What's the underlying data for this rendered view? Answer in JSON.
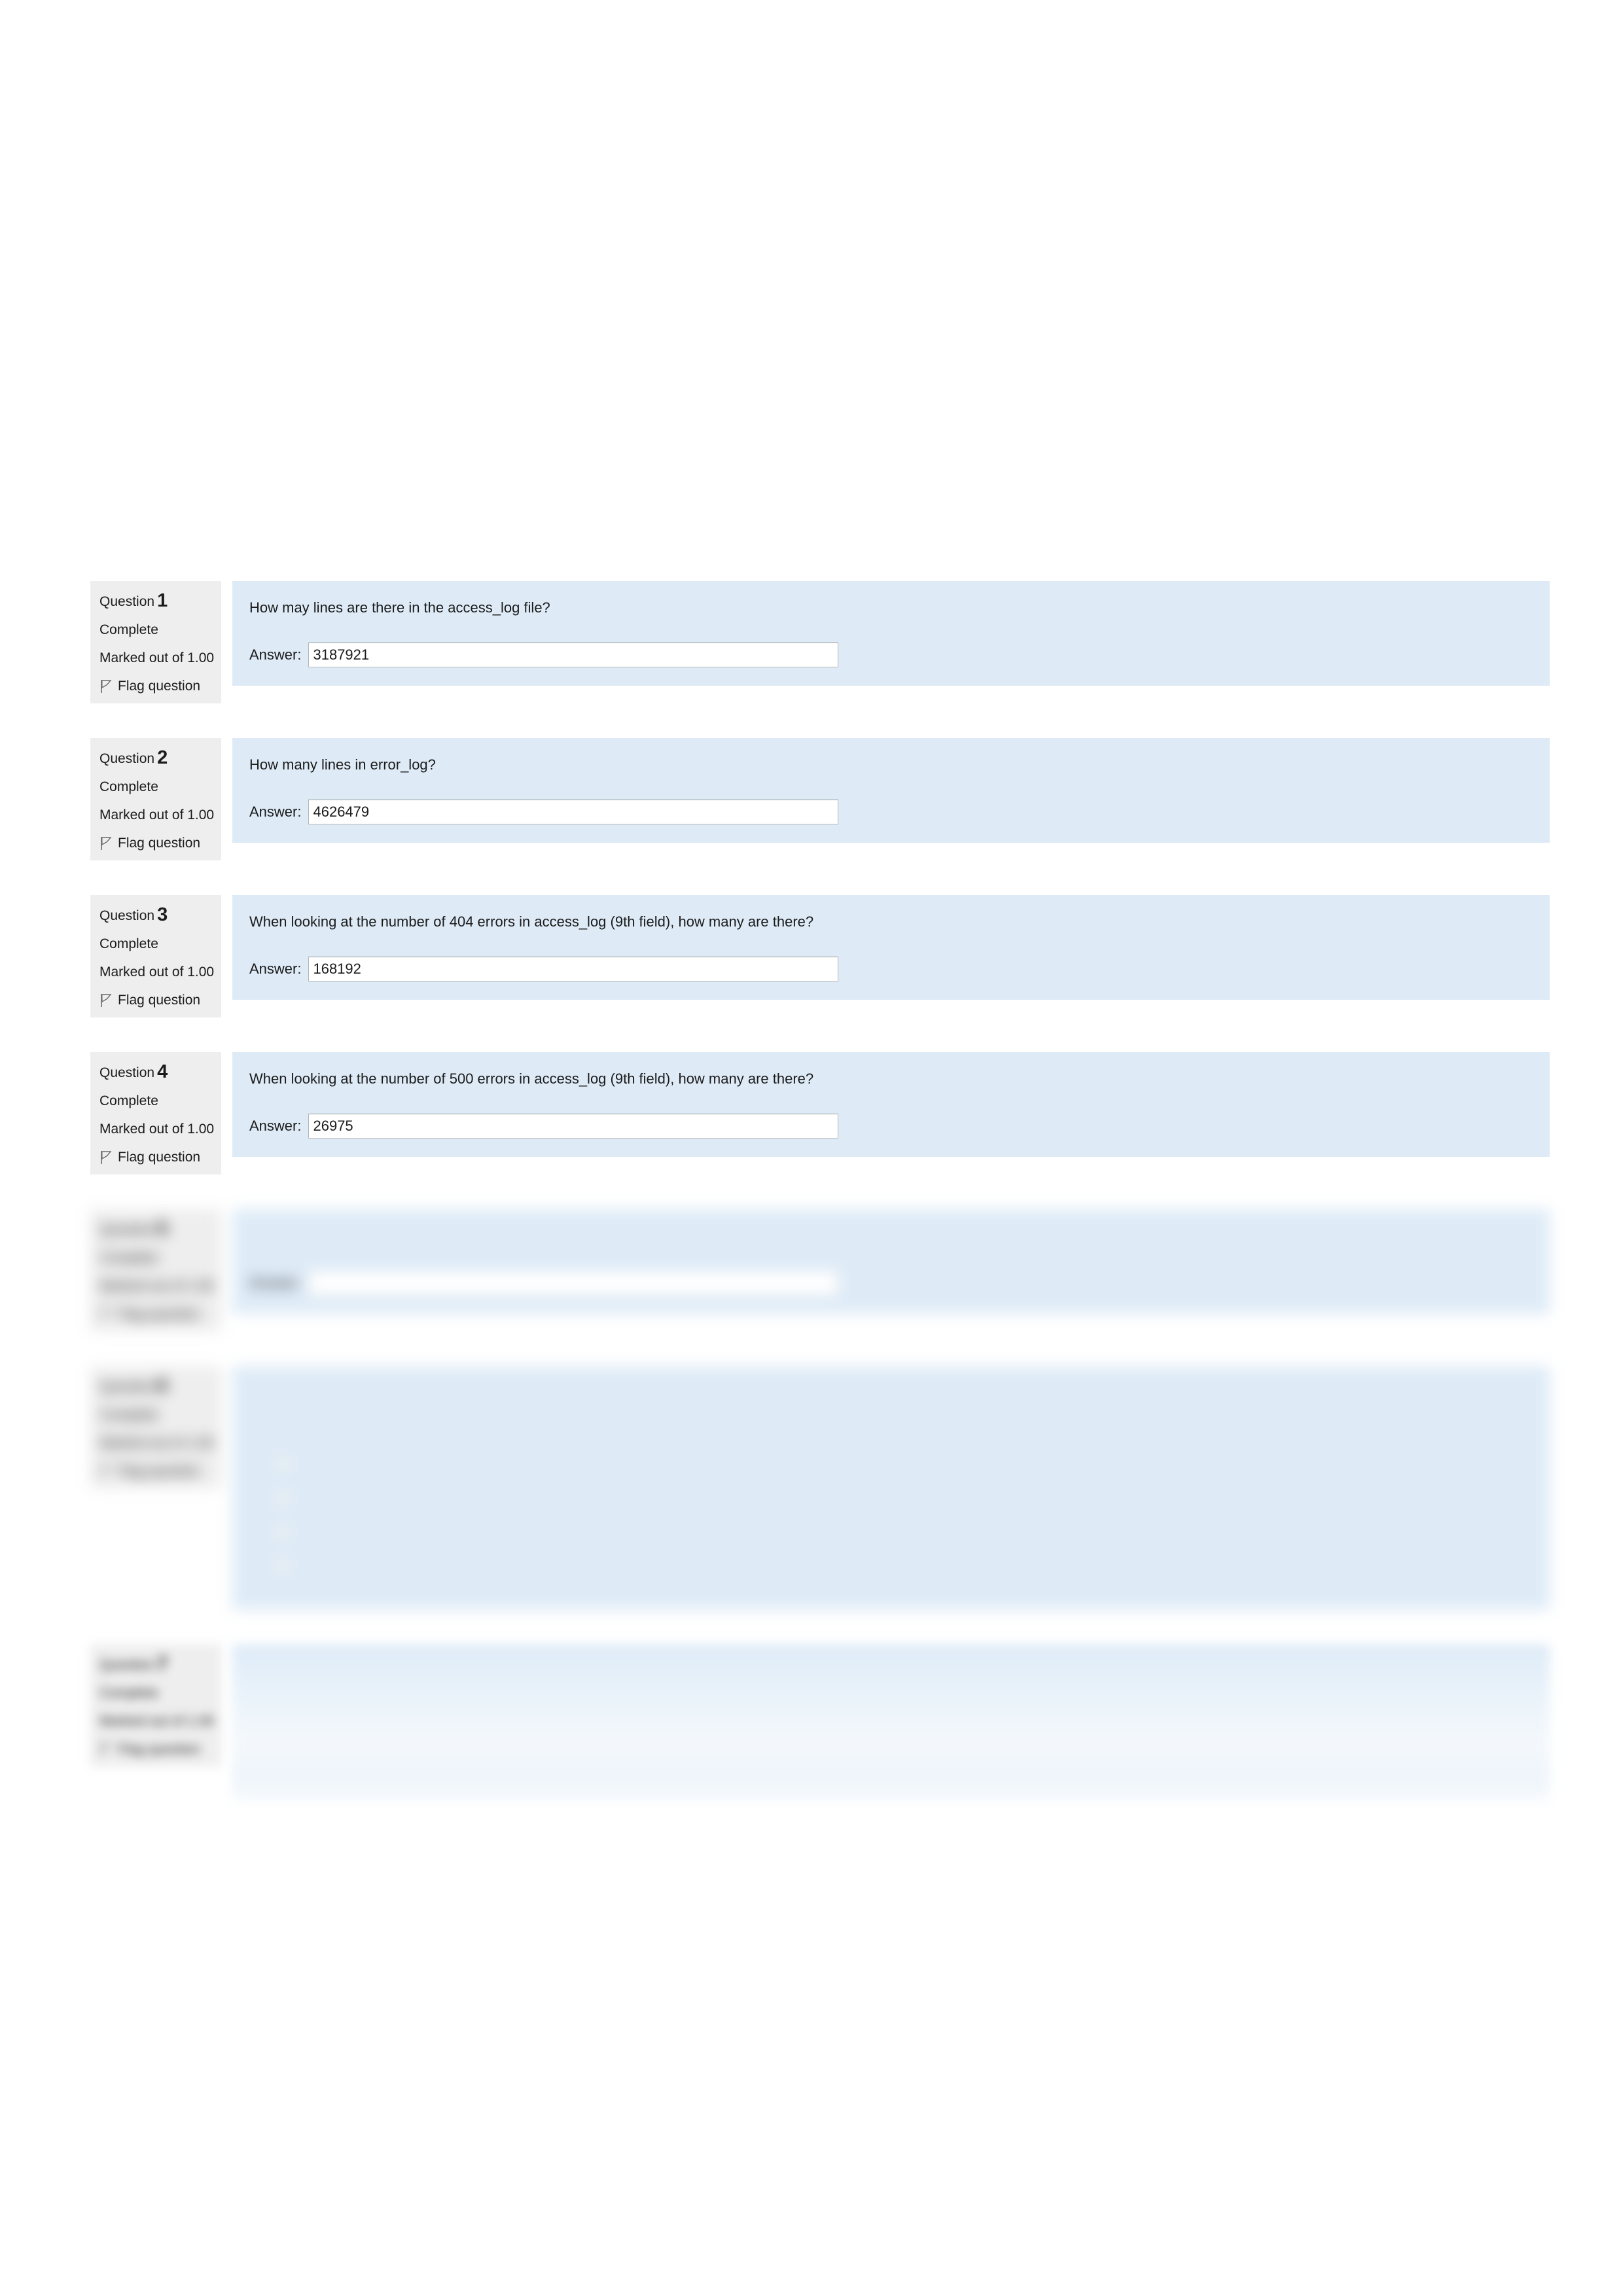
{
  "page": {
    "background": "#ffffff",
    "content_background": "#deebf7",
    "info_background": "#eeeeee"
  },
  "labels": {
    "question_word": "Question",
    "answer_label": "Answer:",
    "flag_label": "Flag question",
    "flag_icon": "flag-icon"
  },
  "questions": [
    {
      "number": "1",
      "state": "Complete",
      "grade": "Marked out of 1.00",
      "flag": "Flag question",
      "text": "How may lines are there in the access_log file?",
      "answer_label": "Answer:",
      "answer_value": "3187921",
      "answer_placeholder": "",
      "type": "shortanswer",
      "redacted": false
    },
    {
      "number": "2",
      "state": "Complete",
      "grade": "Marked out of 1.00",
      "flag": "Flag question",
      "text": "How many lines in error_log?",
      "answer_label": "Answer:",
      "answer_value": "4626479",
      "answer_placeholder": "",
      "type": "shortanswer",
      "redacted": false
    },
    {
      "number": "3",
      "state": "Complete",
      "grade": "Marked out of 1.00",
      "flag": "Flag question",
      "text": "When looking at the number of 404 errors in access_log (9th field), how many are there?",
      "answer_label": "Answer:",
      "answer_value": "168192",
      "answer_placeholder": "",
      "type": "shortanswer",
      "redacted": false
    },
    {
      "number": "4",
      "state": "Complete",
      "grade": "Marked out of 1.00",
      "flag": "Flag question",
      "text": "When looking at the number of 500 errors in access_log (9th field), how many are there?",
      "answer_label": "Answer:",
      "answer_value": "26975",
      "answer_placeholder": "",
      "type": "shortanswer",
      "redacted": true
    },
    {
      "number": "5",
      "state": "Complete",
      "grade": "Marked out of 1.00",
      "flag": "Flag question",
      "text": "",
      "answer_label": "Answer:",
      "answer_value": "",
      "answer_placeholder": "",
      "type": "shortanswer",
      "redacted": true
    },
    {
      "number": "6",
      "state": "Complete",
      "grade": "Marked out of 1.00",
      "flag": "Flag question",
      "text": "",
      "mc_prompt": "",
      "options": [
        "",
        "",
        "",
        ""
      ],
      "type": "multichoice",
      "redacted": true
    },
    {
      "number": "7",
      "state": "Complete",
      "grade": "Marked out of 1.00",
      "flag": "Flag question",
      "text": "",
      "subtext": "",
      "type": "essay",
      "redacted": true
    }
  ]
}
